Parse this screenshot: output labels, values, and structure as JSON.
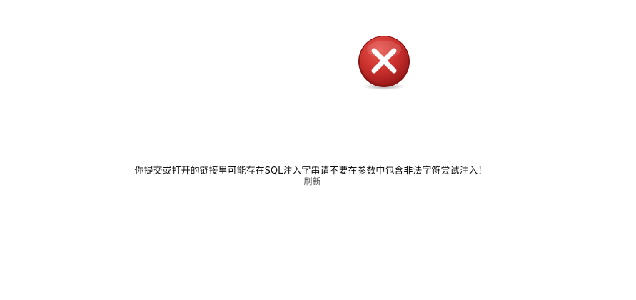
{
  "error_icon": "close-x-icon",
  "colors": {
    "icon_red": "#cc2a2a",
    "icon_red_dark": "#9e1b1b",
    "text": "#111111",
    "link": "#555555"
  },
  "message": "你提交或打开的链接里可能存在SQL注入字串请不要在参数中包含非法字符尝试注入！",
  "refresh_label": "刷新"
}
